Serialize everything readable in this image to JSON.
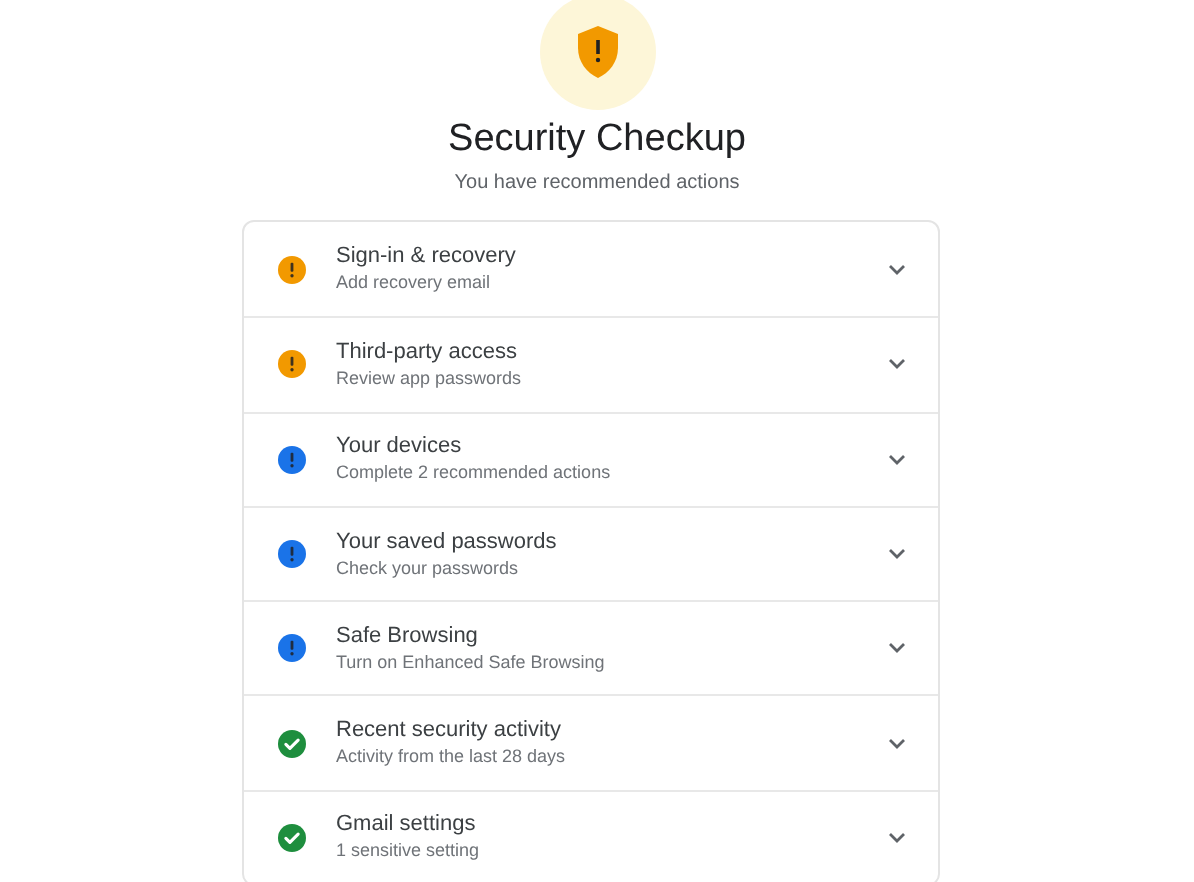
{
  "header": {
    "title": "Security Checkup",
    "subtitle": "You have recommended actions"
  },
  "items": [
    {
      "title": "Sign-in & recovery",
      "detail": "Add recovery email",
      "kind": "alert",
      "color": "#f29900"
    },
    {
      "title": "Third-party access",
      "detail": "Review app passwords",
      "kind": "alert",
      "color": "#f29900"
    },
    {
      "title": "Your devices",
      "detail": "Complete 2 recommended actions",
      "kind": "alert",
      "color": "#1a73e8"
    },
    {
      "title": "Your saved passwords",
      "detail": "Check your passwords",
      "kind": "alert",
      "color": "#1a73e8"
    },
    {
      "title": "Safe Browsing",
      "detail": "Turn on Enhanced Safe Browsing",
      "kind": "alert",
      "color": "#1a73e8"
    },
    {
      "title": "Recent security activity",
      "detail": "Activity from the last 28 days",
      "kind": "done",
      "color": "#1e8e3e"
    },
    {
      "title": "Gmail settings",
      "detail": "1 sensitive setting",
      "kind": "done",
      "color": "#1e8e3e"
    }
  ]
}
